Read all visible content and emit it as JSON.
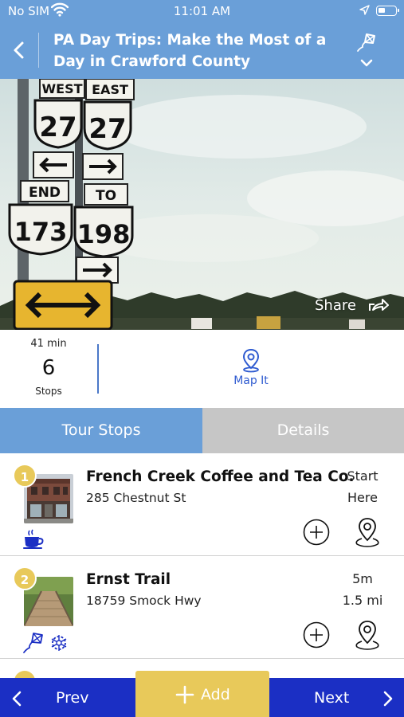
{
  "status_bar": {
    "carrier": "No SIM",
    "time": "11:01 AM"
  },
  "header": {
    "title": "PA Day Trips: Make the Most of a Day in Crawford County",
    "back_icon": "chevron-left-icon",
    "kite_icon": "kite-icon",
    "expand_icon": "chevron-down-icon"
  },
  "hero": {
    "signs": {
      "west": "WEST",
      "east": "EAST",
      "route_top_left": "27",
      "route_top_right": "27",
      "end": "END",
      "to": "TO",
      "route_bottom_left": "173",
      "route_bottom_right": "198"
    },
    "share_label": "Share",
    "share_icon": "share-icon"
  },
  "summary": {
    "duration": "41 min",
    "stop_count": "6",
    "stops_label": "Stops",
    "map_it_label": "Map It",
    "map_icon": "map-pin-icon"
  },
  "tabs": [
    {
      "label": "Tour Stops",
      "active": true
    },
    {
      "label": "Details",
      "active": false
    }
  ],
  "stops": [
    {
      "number": "1",
      "name": "French Creek Coffee and Tea Co.",
      "address": "285 Chestnut St",
      "meta_line1": "Start",
      "meta_line2": "Here",
      "category_icons": [
        "coffee-cup-icon"
      ]
    },
    {
      "number": "2",
      "name": "Ernst Trail",
      "address": "18759 Smock Hwy",
      "meta_line1": "5m",
      "meta_line2": "1.5 mi",
      "category_icons": [
        "kite-icon",
        "snowflake-sun-icon"
      ]
    }
  ],
  "bottom_nav": {
    "prev_label": "Prev",
    "add_label": "Add",
    "next_label": "Next"
  },
  "colors": {
    "header_blue": "#6a9fd8",
    "nav_blue": "#1b2fc4",
    "accent_yellow": "#e8c95a",
    "link_blue": "#2f5bd0",
    "tab_inactive": "#c6c6c6"
  }
}
